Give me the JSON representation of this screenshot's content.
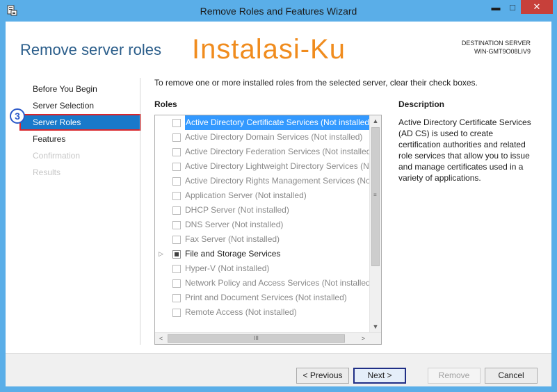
{
  "window": {
    "title": "Remove Roles and Features Wizard",
    "controls": {
      "minimize": "▬",
      "maximize": "□",
      "close": "✕"
    }
  },
  "header": {
    "page_title": "Remove server roles",
    "watermark": "Instalasi-Ku",
    "destination_label": "DESTINATION SERVER",
    "destination_server": "WIN-GMT9O08LIV9"
  },
  "nav": {
    "step_badge": "3",
    "items": [
      {
        "label": "Before You Begin",
        "state": "normal"
      },
      {
        "label": "Server Selection",
        "state": "normal"
      },
      {
        "label": "Server Roles",
        "state": "active"
      },
      {
        "label": "Features",
        "state": "normal"
      },
      {
        "label": "Confirmation",
        "state": "disabled"
      },
      {
        "label": "Results",
        "state": "disabled"
      }
    ]
  },
  "content": {
    "instructions": "To remove one or more installed roles from the selected server, clear their check boxes.",
    "roles_heading": "Roles",
    "description_heading": "Description",
    "description_text": "Active Directory Certificate Services (AD CS) is used to create certification authorities and related role services that allow you to issue and manage certificates used in a variety of applications.",
    "roles": [
      {
        "label": "Active Directory Certificate Services (Not installed)",
        "selected": true,
        "enabled": false,
        "partial": false,
        "expander": false
      },
      {
        "label": "Active Directory Domain Services (Not installed)",
        "selected": false,
        "enabled": false,
        "partial": false,
        "expander": false
      },
      {
        "label": "Active Directory Federation Services (Not installed)",
        "selected": false,
        "enabled": false,
        "partial": false,
        "expander": false
      },
      {
        "label": "Active Directory Lightweight Directory Services (N",
        "selected": false,
        "enabled": false,
        "partial": false,
        "expander": false
      },
      {
        "label": "Active Directory Rights Management Services (No",
        "selected": false,
        "enabled": false,
        "partial": false,
        "expander": false
      },
      {
        "label": "Application Server (Not installed)",
        "selected": false,
        "enabled": false,
        "partial": false,
        "expander": false
      },
      {
        "label": "DHCP Server (Not installed)",
        "selected": false,
        "enabled": false,
        "partial": false,
        "expander": false
      },
      {
        "label": "DNS Server (Not installed)",
        "selected": false,
        "enabled": false,
        "partial": false,
        "expander": false
      },
      {
        "label": "Fax Server (Not installed)",
        "selected": false,
        "enabled": false,
        "partial": false,
        "expander": false
      },
      {
        "label": "File and Storage Services",
        "selected": false,
        "enabled": true,
        "partial": true,
        "expander": true
      },
      {
        "label": "Hyper-V (Not installed)",
        "selected": false,
        "enabled": false,
        "partial": false,
        "expander": false
      },
      {
        "label": "Network Policy and Access Services (Not installed)",
        "selected": false,
        "enabled": false,
        "partial": false,
        "expander": false
      },
      {
        "label": "Print and Document Services (Not installed)",
        "selected": false,
        "enabled": false,
        "partial": false,
        "expander": false
      },
      {
        "label": "Remote Access (Not installed)",
        "selected": false,
        "enabled": false,
        "partial": false,
        "expander": false
      }
    ]
  },
  "footer": {
    "previous_label": "< Previous",
    "next_label": "Next >",
    "remove_label": "Remove",
    "cancel_label": "Cancel"
  },
  "icons": {
    "expander": "▷",
    "scroll_up": "▲",
    "scroll_down": "▼",
    "scroll_left": "<",
    "scroll_right": ">",
    "vgrip": "≡",
    "hgrip": "III"
  },
  "colors": {
    "accent": "#1979ca",
    "highlight_border": "#d9262b",
    "watermark": "#f08c1e",
    "selection": "#3399ff",
    "next_border": "#1f2e85"
  }
}
